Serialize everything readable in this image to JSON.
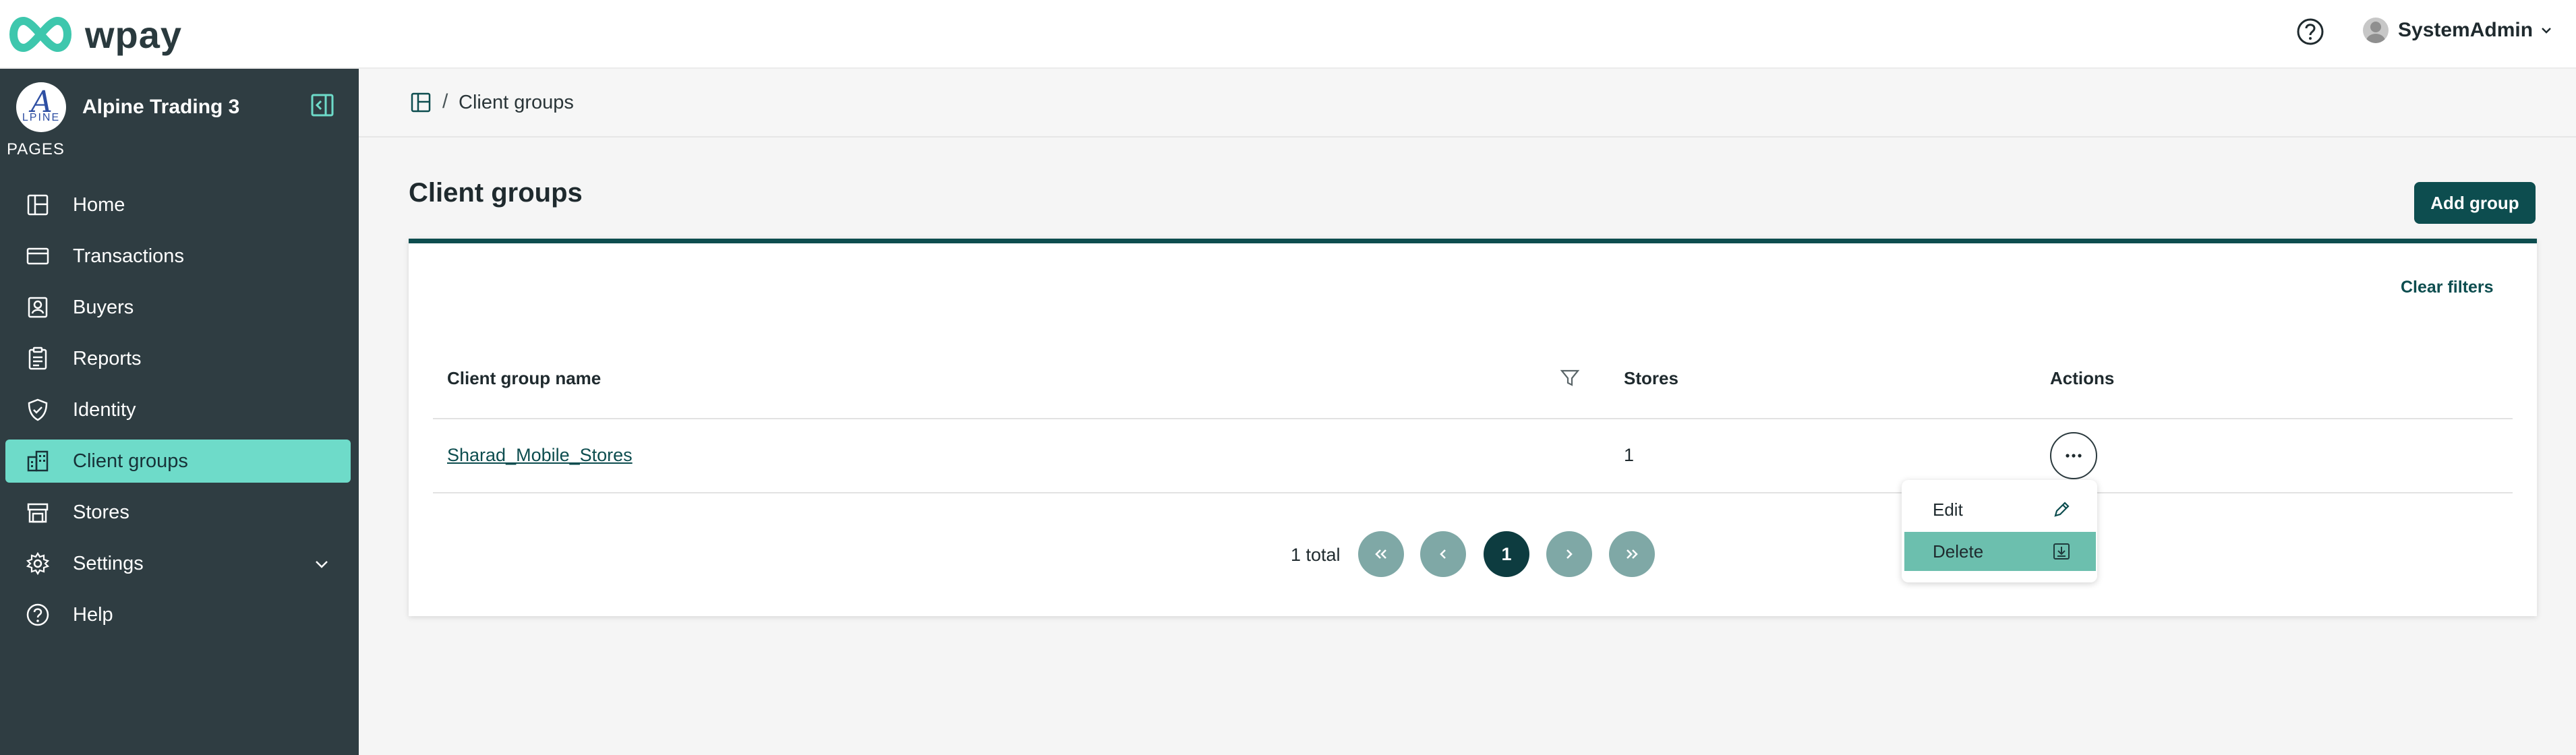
{
  "app": {
    "logo_text": "wpay"
  },
  "topbar": {
    "user_name": "SystemAdmin"
  },
  "sidebar": {
    "org_name": "Alpine Trading 3",
    "org_logo_letter": "A",
    "org_logo_word": "LPINE",
    "section_label": "PAGES",
    "items": [
      {
        "label": "Home",
        "icon": "home-icon"
      },
      {
        "label": "Transactions",
        "icon": "card-icon"
      },
      {
        "label": "Buyers",
        "icon": "buyers-icon"
      },
      {
        "label": "Reports",
        "icon": "reports-icon"
      },
      {
        "label": "Identity",
        "icon": "shield-icon"
      },
      {
        "label": "Client groups",
        "icon": "building-icon",
        "active": true
      },
      {
        "label": "Stores",
        "icon": "store-icon"
      },
      {
        "label": "Settings",
        "icon": "gear-icon"
      },
      {
        "label": "Help",
        "icon": "help-icon"
      }
    ]
  },
  "breadcrumb": {
    "separator": "/",
    "current": "Client groups"
  },
  "page": {
    "title": "Client groups",
    "add_button": "Add group"
  },
  "table": {
    "clear_filters": "Clear filters",
    "columns": [
      "Client group name",
      "Stores",
      "Actions"
    ],
    "rows": [
      {
        "name": "Sharad_Mobile_Stores",
        "stores": "1"
      }
    ]
  },
  "pagination": {
    "total": "1 total",
    "current_page": "1"
  },
  "row_menu": {
    "items": [
      {
        "label": "Edit",
        "icon": "pencil-icon"
      },
      {
        "label": "Delete",
        "icon": "delete-icon",
        "highlighted": true
      }
    ]
  },
  "colors": {
    "accent_dark": "#0d4d4f",
    "sidebar_bg": "#2f3d42",
    "active_nav": "#6edbc9",
    "menu_highlight": "#6cbfae"
  }
}
